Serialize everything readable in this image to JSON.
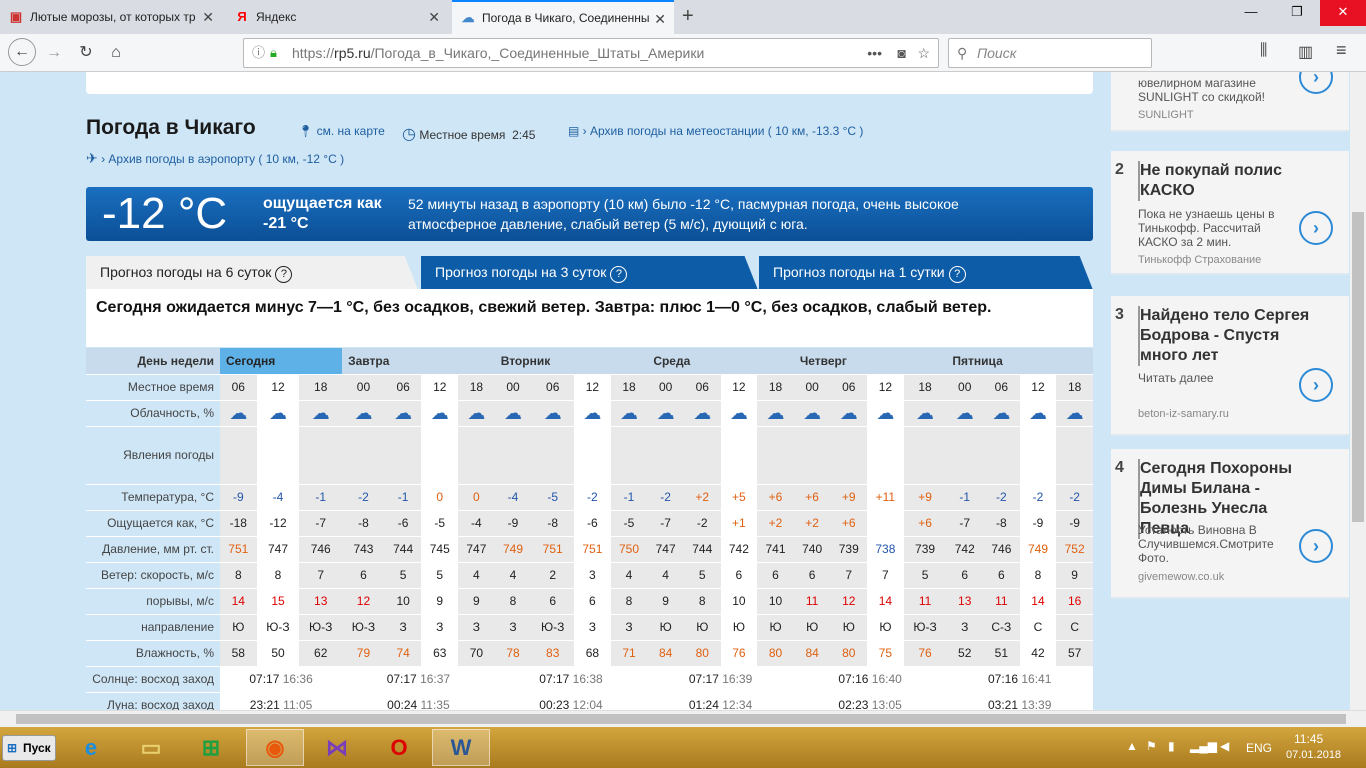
{
  "tabs": [
    {
      "title": "Лютые морозы, от которых тр",
      "icon": "cat-icon"
    },
    {
      "title": "Яндекс",
      "icon": "Я"
    },
    {
      "title": "Погода в Чикаго, Соединенны",
      "icon": "weather-icon"
    }
  ],
  "url": {
    "prefix": "https://",
    "domain": "rp5.ru",
    "path": "/Погода_в_Чикаго,_Соединенные_Штаты_Америки"
  },
  "search_placeholder": "Поиск",
  "page": {
    "title": "Погода в Чикаго",
    "map_link": "см. на карте",
    "local_time_label": "Местное время",
    "local_time": "2:45",
    "archive_station": "Архив погоды на метеостанции ( 10 км, -13.3 °C )",
    "archive_airport": "Архив погоды в аэропорту ( 10 км, -12 °C )",
    "current_temp": "-12 °C",
    "feels_label": "ощущается как -21 °C",
    "current_desc": "52 минуты назад в аэропорту (10 км) было -12 °C, пасмурная погода, очень высокое атмосферное давление, слабый ветер (5 м/с), дующий с юга.",
    "forecast_tabs": [
      "Прогноз погоды на 6 суток",
      "Прогноз погоды на 3 суток",
      "Прогноз погоды на 1 сутки"
    ],
    "summary": "Сегодня ожидается минус 7—1 °C, без осадков, свежий ветер. Завтра: плюс 1—0 °C, без осадков, слабый ветер."
  },
  "forecast": {
    "labels": {
      "day": "День недели",
      "time": "Местное время",
      "cloud": "Облачность, %",
      "phen": "Явления погоды",
      "temp": "Температура, °C",
      "feels": "Ощущается как, °C",
      "press": "Давление, мм рт. ст.",
      "wind": "Ветер: скорость, м/с",
      "gust": "порывы, м/с",
      "dir": "направление",
      "hum": "Влажность, %",
      "sun": "Солнце: восход заход",
      "moon": "Луна: восход заход"
    },
    "days": [
      {
        "name": "Сегодня",
        "cols": 3
      },
      {
        "name": "Завтра",
        "cols": 4
      },
      {
        "name": "Вторник",
        "cols": 4
      },
      {
        "name": "Среда",
        "cols": 4
      },
      {
        "name": "Четверг",
        "cols": 4
      },
      {
        "name": "Пятница",
        "cols": 4
      }
    ],
    "times": [
      "06",
      "12",
      "18",
      "00",
      "06",
      "12",
      "18",
      "00",
      "06",
      "12",
      "18",
      "00",
      "06",
      "12",
      "18",
      "00",
      "06",
      "12",
      "18",
      "00",
      "06",
      "12",
      "18"
    ],
    "temp": [
      "-9",
      "-4",
      "-1",
      "-2",
      "-1",
      "0",
      "0",
      "-4",
      "-5",
      "-2",
      "-1",
      "-2",
      "+2",
      "+5",
      "+6",
      "+6",
      "+9",
      "+11",
      "+9",
      "-1",
      "-2",
      "-2",
      "-2"
    ],
    "feels": [
      "-18",
      "-12",
      "-7",
      "-8",
      "-6",
      "-5",
      "-4",
      "-9",
      "-8",
      "-6",
      "-5",
      "-7",
      "-2",
      "+1",
      "+2",
      "+2",
      "+6",
      "",
      "+6",
      "-7",
      "-8",
      "-9",
      "-9"
    ],
    "press": [
      "751",
      "747",
      "746",
      "743",
      "744",
      "745",
      "747",
      "749",
      "751",
      "751",
      "750",
      "747",
      "744",
      "742",
      "741",
      "740",
      "739",
      "738",
      "739",
      "742",
      "746",
      "749",
      "752"
    ],
    "wind": [
      "8",
      "8",
      "7",
      "6",
      "5",
      "5",
      "4",
      "4",
      "2",
      "3",
      "4",
      "4",
      "5",
      "6",
      "6",
      "6",
      "7",
      "7",
      "5",
      "6",
      "6",
      "8",
      "9"
    ],
    "gust": [
      "14",
      "15",
      "13",
      "12",
      "10",
      "9",
      "9",
      "8",
      "6",
      "6",
      "8",
      "9",
      "8",
      "10",
      "10",
      "11",
      "12",
      "14",
      "11",
      "13",
      "11",
      "14",
      "16"
    ],
    "dir": [
      "Ю",
      "Ю-З",
      "Ю-З",
      "Ю-З",
      "З",
      "З",
      "З",
      "З",
      "Ю-З",
      "З",
      "З",
      "Ю",
      "Ю",
      "Ю",
      "Ю",
      "Ю",
      "Ю",
      "Ю",
      "Ю-З",
      "З",
      "С-З",
      "С",
      "С"
    ],
    "hum": [
      "58",
      "50",
      "62",
      "79",
      "74",
      "63",
      "70",
      "78",
      "83",
      "68",
      "71",
      "84",
      "80",
      "76",
      "80",
      "84",
      "80",
      "75",
      "76",
      "52",
      "51",
      "42",
      "57"
    ],
    "sun": [
      [
        "07:17",
        "16:36"
      ],
      [
        "07:17",
        "16:37"
      ],
      [
        "07:17",
        "16:38"
      ],
      [
        "07:17",
        "16:39"
      ],
      [
        "07:16",
        "16:40"
      ],
      [
        "07:16",
        "16:41"
      ]
    ],
    "moon": [
      [
        "23:21",
        "11:05"
      ],
      [
        "00:24",
        "11:35"
      ],
      [
        "00:23",
        "12:04"
      ],
      [
        "01:24",
        "12:34"
      ],
      [
        "02:23",
        "13:05"
      ],
      [
        "03:21",
        "13:39"
      ]
    ]
  },
  "ads": [
    {
      "num": "",
      "title": "",
      "desc": "ювелирном магазине SUNLIGHT со скидкой!",
      "src": "SUNLIGHT"
    },
    {
      "num": "2",
      "title": "Не покупай полис КАСКО",
      "desc": "Пока не узнаешь цены в Тинькофф. Рассчитай КАСКО за 2 мин.",
      "src": "Тинькофф Страхование"
    },
    {
      "num": "3",
      "title": "Найдено тело Сергея Бодрова - Спустя много лет",
      "desc": "Читать далее",
      "src": "beton-iz-samary.ru"
    },
    {
      "num": "4",
      "title": "Сегодня Похороны Димы Билана - Болезнь Унесла Певца",
      "desc": "Усталость Виновна В Случившемся.Смотрите Фото.",
      "src": "givemewow.co.uk"
    }
  ],
  "taskbar": {
    "start": "Пуск",
    "lang": "ENG",
    "time": "11:45",
    "date": "07.01.2018"
  }
}
